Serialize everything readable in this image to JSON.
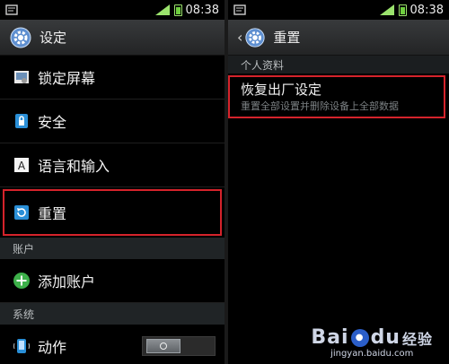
{
  "status_left": {
    "time": "08:38"
  },
  "status_right": {
    "time": "08:38"
  },
  "left": {
    "title": "设定",
    "items": [
      {
        "label": "锁定屏幕",
        "icon": "lock-screen-icon"
      },
      {
        "label": "安全",
        "icon": "security-lock-icon"
      },
      {
        "label": "语言和输入",
        "icon": "language-icon"
      },
      {
        "label": "重置",
        "icon": "reset-icon"
      }
    ],
    "section_accounts": "账户",
    "add_account": {
      "label": "添加账户",
      "icon": "add-icon"
    },
    "section_system": "系统",
    "motion": {
      "label": "动作",
      "icon": "motion-icon"
    }
  },
  "right": {
    "title": "重置",
    "section": "个人资料",
    "factory_title": "恢复出厂设定",
    "factory_subtitle": "重置全部设置并删除设备上全部数据"
  },
  "watermark": {
    "logo_left": "Bai",
    "logo_mid": "du",
    "logo_right": "经验",
    "url": "jingyan.baidu.com"
  },
  "colors": {
    "highlight": "#d5232b",
    "actionbar": "#2e3032"
  }
}
